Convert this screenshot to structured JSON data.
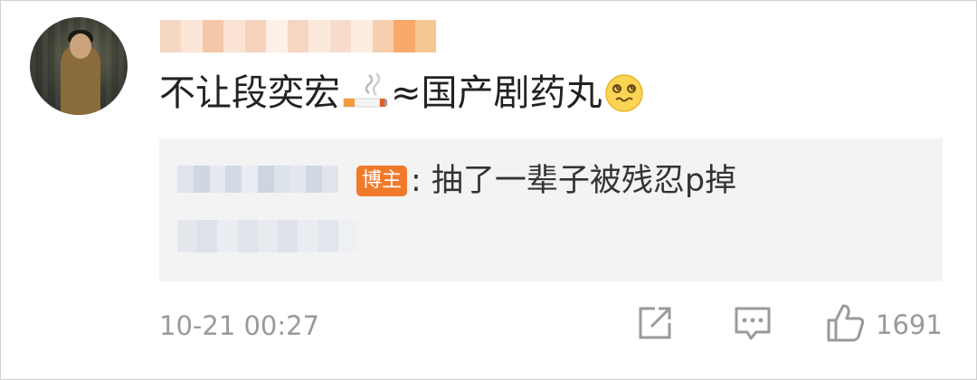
{
  "comment": {
    "author_name": "",
    "text_main": "不让段奕宏",
    "icon_cigarette": "cigarette-emoji",
    "text_after": "≈国产剧药丸",
    "icon_face": "dizzy-face-emoji"
  },
  "reply": {
    "badge": "博主",
    "text": ": 抽了一辈子被残忍p掉"
  },
  "footer": {
    "timestamp": "10-21 00:27",
    "like_count": "1691",
    "icons": [
      "share-icon",
      "comment-icon",
      "like-icon"
    ]
  },
  "colors": {
    "badge": "#f07a2a",
    "text_primary": "#222222",
    "text_secondary": "#9a9a9a",
    "reply_bg": "#f3f3f3"
  }
}
